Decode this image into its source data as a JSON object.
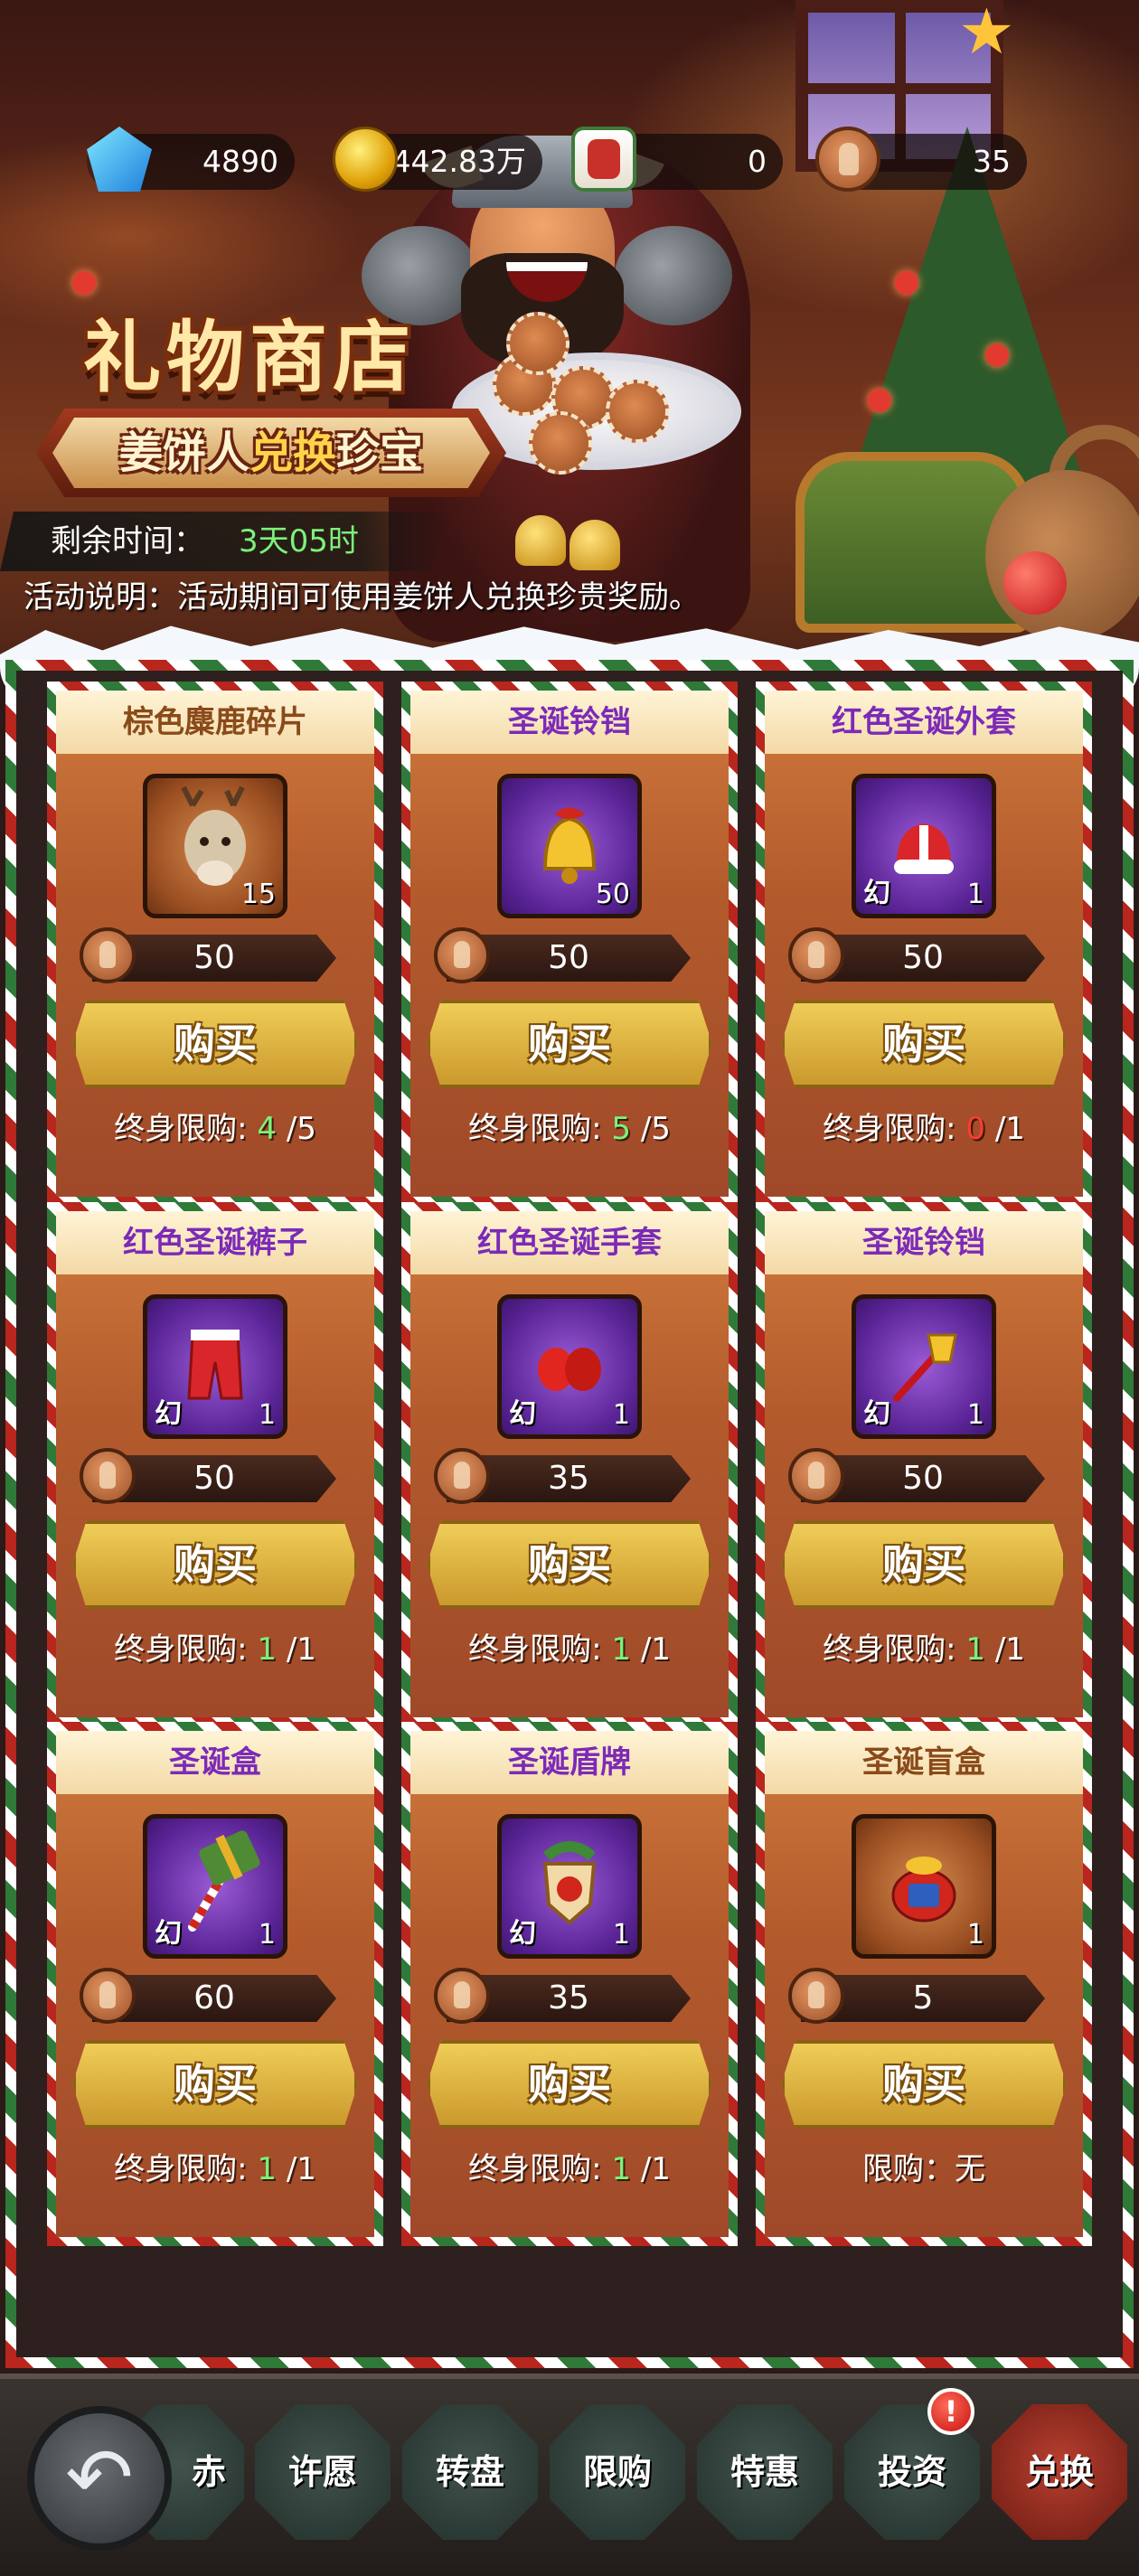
{
  "currencies": [
    {
      "icon": "diamond-icon",
      "value": "4890"
    },
    {
      "icon": "gold-coin-icon",
      "value": "442.83万"
    },
    {
      "icon": "stocking-icon",
      "value": "0"
    },
    {
      "icon": "gingerbread-icon",
      "value": "35"
    }
  ],
  "shop": {
    "title": "礼物商店",
    "subtitle_part1": "姜饼人",
    "subtitle_part2": "兑换",
    "subtitle_part3": "珍宝",
    "timer_label": "剩余时间：",
    "timer_value": "3天05时",
    "description": "活动说明：活动期间可使用姜饼人兑换珍贵奖励。"
  },
  "items": [
    {
      "name": "棕色麋鹿碎片",
      "icon": "reindeer-icon",
      "tag": "",
      "count": "15",
      "price": "50",
      "buy_label": "购买",
      "limit_label": "终身限购:",
      "limit_bought": "4",
      "limit_total": "/5"
    },
    {
      "name": "圣诞铃铛",
      "icon": "golden-bell-icon",
      "tag": "",
      "count": "50",
      "price": "50",
      "buy_label": "购买",
      "limit_label": "终身限购:",
      "limit_bought": "5",
      "limit_total": "/5"
    },
    {
      "name": "红色圣诞外套",
      "icon": "santa-coat-icon",
      "tag": "幻",
      "count": "1",
      "price": "50",
      "buy_label": "购买",
      "limit_label": "终身限购:",
      "limit_bought": "0",
      "limit_total": "/1"
    },
    {
      "name": "红色圣诞裤子",
      "icon": "santa-pants-icon",
      "tag": "幻",
      "count": "1",
      "price": "50",
      "buy_label": "购买",
      "limit_label": "终身限购:",
      "limit_bought": "1",
      "limit_total": "/1"
    },
    {
      "name": "红色圣诞手套",
      "icon": "santa-gloves-icon",
      "tag": "幻",
      "count": "1",
      "price": "35",
      "buy_label": "购买",
      "limit_label": "终身限购:",
      "limit_bought": "1",
      "limit_total": "/1"
    },
    {
      "name": "圣诞铃铛",
      "icon": "bell-wand-icon",
      "tag": "幻",
      "count": "1",
      "price": "50",
      "buy_label": "购买",
      "limit_label": "终身限购:",
      "limit_bought": "1",
      "limit_total": "/1"
    },
    {
      "name": "圣诞盒",
      "icon": "gift-hammer-icon",
      "tag": "幻",
      "count": "1",
      "price": "60",
      "buy_label": "购买",
      "limit_label": "终身限购:",
      "limit_bought": "1",
      "limit_total": "/1"
    },
    {
      "name": "圣诞盾牌",
      "icon": "christmas-shield-icon",
      "tag": "幻",
      "count": "1",
      "price": "35",
      "buy_label": "购买",
      "limit_label": "终身限购:",
      "limit_bought": "1",
      "limit_total": "/1"
    },
    {
      "name": "圣诞盲盒",
      "icon": "lucky-bag-icon",
      "tag": "",
      "count": "1",
      "price": "5",
      "buy_label": "购买",
      "limit_label": "限购：",
      "limit_bought": "",
      "limit_total": "无"
    }
  ],
  "nav": {
    "back_icon": "back-arrow-icon",
    "tabs": [
      {
        "label": "许愿"
      },
      {
        "label": "转盘"
      },
      {
        "label": "限购"
      },
      {
        "label": "特惠"
      },
      {
        "label": "投资",
        "badge": "!"
      },
      {
        "label": "兑换"
      }
    ],
    "partial_label": "赤"
  },
  "colors": {
    "accent_green": "#7cf27a",
    "warn_red": "#ff3b2f",
    "title_purple": "#7c2ab8",
    "button_gold": "#f1cf5a",
    "active_tab": "#b84030"
  }
}
